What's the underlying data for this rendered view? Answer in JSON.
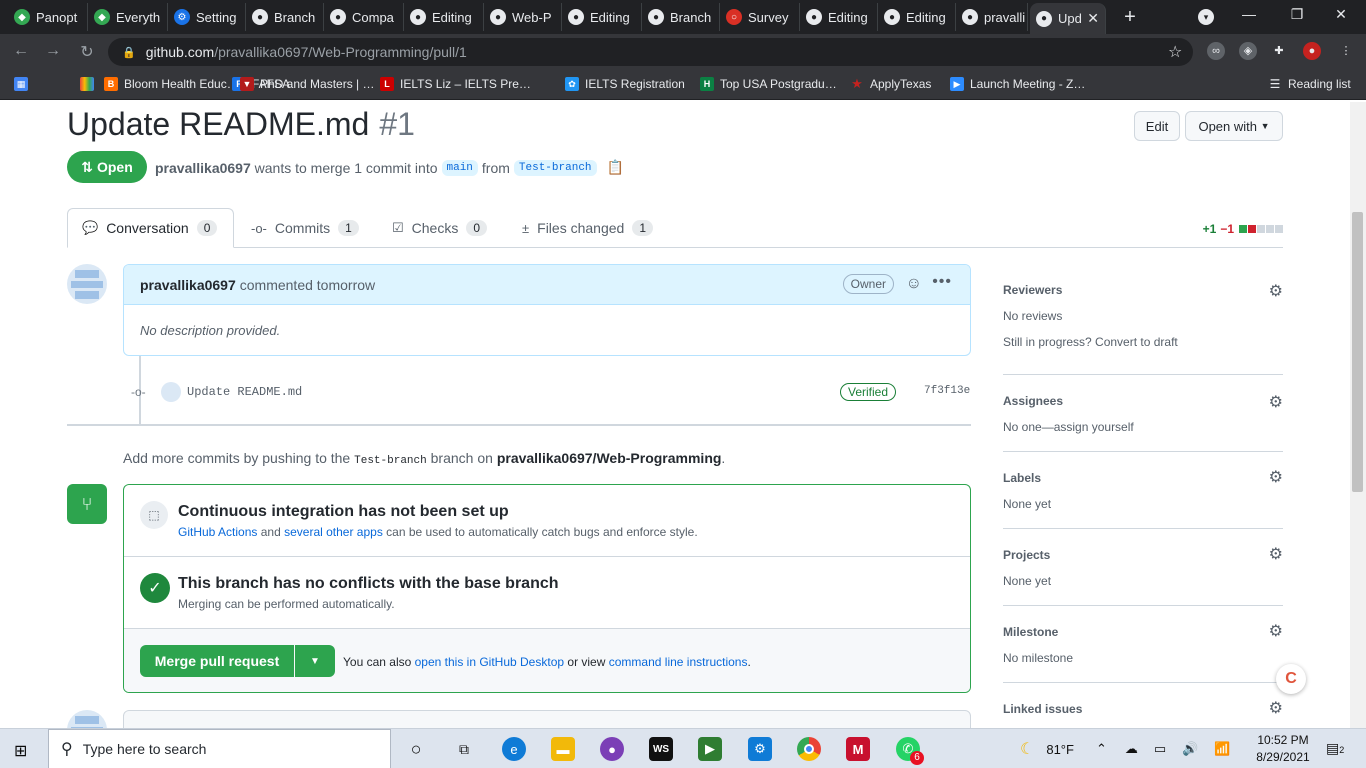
{
  "browser": {
    "tabs": [
      {
        "label": "Panopt",
        "color": "#34a853"
      },
      {
        "label": "Everyth",
        "color": "#34a853"
      },
      {
        "label": "Setting",
        "color": "#1a73e8"
      },
      {
        "label": "Branch",
        "color": "#e8eaed"
      },
      {
        "label": "Compa",
        "color": "#e8eaed"
      },
      {
        "label": "Editing",
        "color": "#e8eaed"
      },
      {
        "label": "Web-P",
        "color": "#e8eaed"
      },
      {
        "label": "Editing",
        "color": "#e8eaed"
      },
      {
        "label": "Branch",
        "color": "#e8eaed"
      },
      {
        "label": "Survey",
        "color": "#d93025"
      },
      {
        "label": "Editing",
        "color": "#e8eaed"
      },
      {
        "label": "Editing",
        "color": "#e8eaed"
      },
      {
        "label": "pravalli",
        "color": "#e8eaed"
      },
      {
        "label": "Upd",
        "color": "#e8eaed"
      }
    ],
    "new_tab": "+",
    "url_host": "github.com",
    "url_path": "/pravallika0697/Web-Programming/pull/1",
    "bookmarks": [
      {
        "label": "",
        "color": "#4285f4",
        "icon": "apps-icon"
      },
      {
        "label": "",
        "color": "#e8453c",
        "icon": "colorful-icon"
      },
      {
        "label": "Bloom Health Educ…",
        "color": "#ff6d00",
        "icon": "bloom-icon"
      },
      {
        "label": "FAFSA",
        "color": "#1a73e8",
        "icon": "fafsa-icon"
      },
      {
        "label": "PhD and Masters | …",
        "color": "#b31b1b",
        "icon": "shield-icon"
      },
      {
        "label": "IELTS Liz – IELTS Pre…",
        "color": "#cc0000",
        "icon": "liz-icon"
      },
      {
        "label": "IELTS Registration",
        "color": "#2196f3",
        "icon": "ielts-icon"
      },
      {
        "label": "Top USA Postgradu…",
        "color": "#0b8043",
        "icon": "h-icon"
      },
      {
        "label": "ApplyTexas",
        "color": "#c5221f",
        "icon": "star-icon"
      },
      {
        "label": "Launch Meeting - Z…",
        "color": "#2d8cff",
        "icon": "zoom-icon"
      }
    ],
    "reading_list": "Reading list"
  },
  "pr": {
    "title": "Update README.md",
    "number": "#1",
    "edit_label": "Edit",
    "open_with_label": "Open with",
    "state_label": "Open",
    "author": "pravallika0697",
    "merge_text": "wants to merge 1 commit into",
    "base_branch": "main",
    "from_text": "from",
    "head_branch": "Test-branch"
  },
  "tabs": [
    {
      "label": "Conversation",
      "count": "0"
    },
    {
      "label": "Commits",
      "count": "1"
    },
    {
      "label": "Checks",
      "count": "0"
    },
    {
      "label": "Files changed",
      "count": "1"
    }
  ],
  "diffstat": {
    "additions": "+1",
    "deletions": "−1"
  },
  "comment": {
    "author": "pravallika0697",
    "action": "commented tomorrow",
    "badge": "Owner",
    "body": "No description provided."
  },
  "commit": {
    "message": "Update README.md",
    "verified": "Verified",
    "sha": "7f3f13e"
  },
  "push_note": {
    "prefix": "Add more commits by pushing to the",
    "branch": "Test-branch",
    "middle": "branch on",
    "repo": "pravallika0697/Web-Programming",
    "suffix": "."
  },
  "merge": {
    "ci_title": "Continuous integration has not been set up",
    "ci_link1": "GitHub Actions",
    "ci_and": "and",
    "ci_link2": "several other apps",
    "ci_rest": "can be used to automatically catch bugs and enforce style.",
    "ok_title": "This branch has no conflicts with the base branch",
    "ok_sub": "Merging can be performed automatically.",
    "button": "Merge pull request",
    "also_prefix": "You can also",
    "also_link1": "open this in GitHub Desktop",
    "also_or": "or view",
    "also_link2": "command line instructions",
    "also_suffix": "."
  },
  "sidebar": {
    "reviewers": {
      "title": "Reviewers",
      "value": "No reviews",
      "extra": "Still in progress? Convert to draft"
    },
    "assignees": {
      "title": "Assignees",
      "value": "No one—assign yourself"
    },
    "labels": {
      "title": "Labels",
      "value": "None yet"
    },
    "projects": {
      "title": "Projects",
      "value": "None yet"
    },
    "milestone": {
      "title": "Milestone",
      "value": "No milestone"
    },
    "linked": {
      "title": "Linked issues"
    }
  },
  "taskbar": {
    "search_placeholder": "Type here to search",
    "temperature": "81°F",
    "time": "10:52 PM",
    "date": "8/29/2021",
    "notif_count": "2",
    "whatsapp_badge": "6"
  }
}
